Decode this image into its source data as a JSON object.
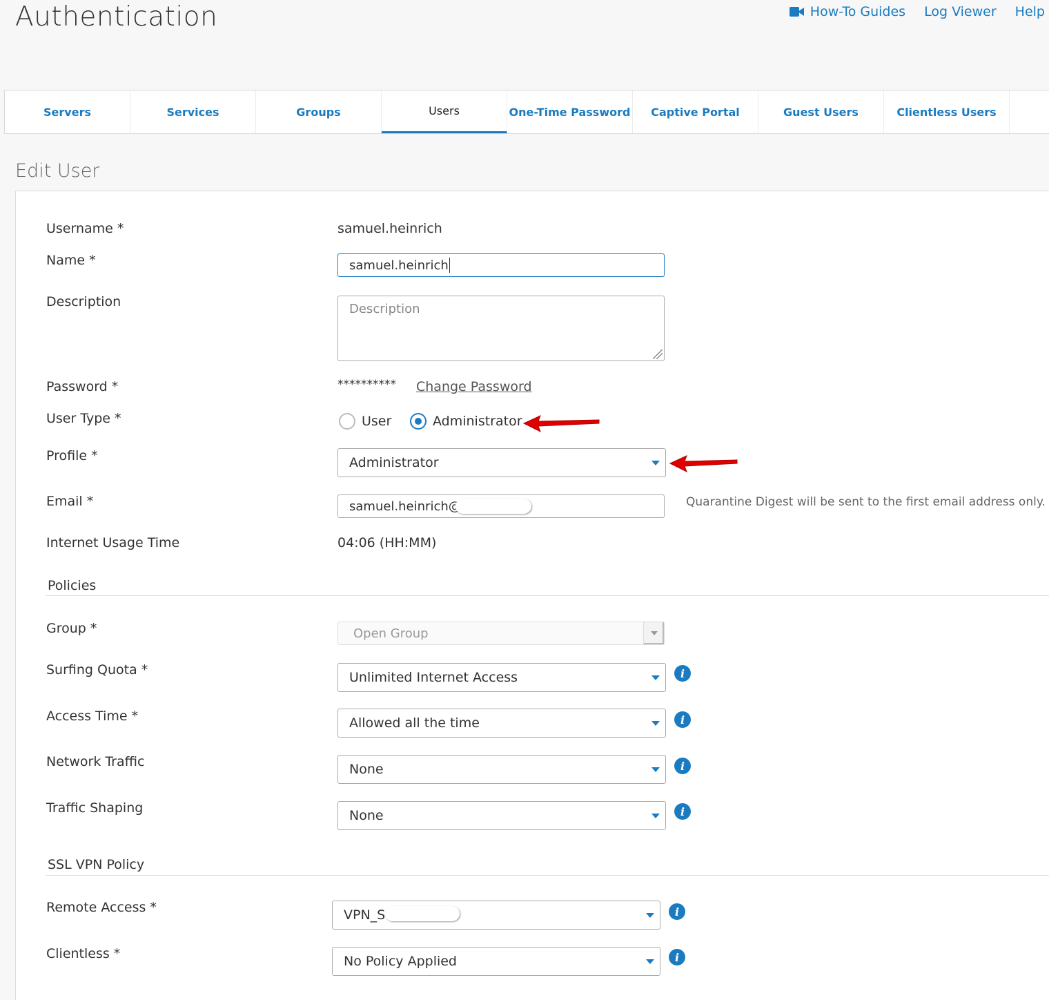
{
  "header": {
    "title": "Authentication",
    "links": [
      "How-To Guides",
      "Log Viewer",
      "Help"
    ]
  },
  "tabs": [
    "Servers",
    "Services",
    "Groups",
    "Users",
    "One-Time Password",
    "Captive Portal",
    "Guest Users",
    "Clientless Users"
  ],
  "active_tab": "Users",
  "section_title": "Edit User",
  "form": {
    "username_label": "Username *",
    "username_value": "samuel.heinrich",
    "name_label": "Name *",
    "name_value": "samuel.heinrich",
    "description_label": "Description",
    "description_placeholder": "Description",
    "password_label": "Password *",
    "password_value": "**********",
    "change_password": "Change Password",
    "user_type_label": "User Type *",
    "user_type_options": [
      "User",
      "Administrator"
    ],
    "user_type_selected": "Administrator",
    "profile_label": "Profile *",
    "profile_value": "Administrator",
    "email_label": "Email *",
    "email_value": "samuel.heinrich@",
    "email_hint": "Quarantine Digest will be sent to the first email address only.",
    "usage_label": "Internet Usage Time",
    "usage_value": "04:06 (HH:MM)"
  },
  "policies": {
    "title": "Policies",
    "group_label": "Group *",
    "group_value": "Open Group",
    "surfing_label": "Surfing Quota *",
    "surfing_value": "Unlimited Internet Access",
    "access_label": "Access Time *",
    "access_value": "Allowed all the time",
    "network_label": "Network Traffic",
    "network_value": "None",
    "shaping_label": "Traffic Shaping",
    "shaping_value": "None"
  },
  "ssl_vpn": {
    "title": "SSL VPN Policy",
    "remote_label": "Remote Access *",
    "remote_value": "VPN_S",
    "clientless_label": "Clientless *",
    "clientless_value": "No Policy Applied"
  },
  "colors": {
    "accent": "#1a7bc0",
    "arrow": "#e00000"
  }
}
